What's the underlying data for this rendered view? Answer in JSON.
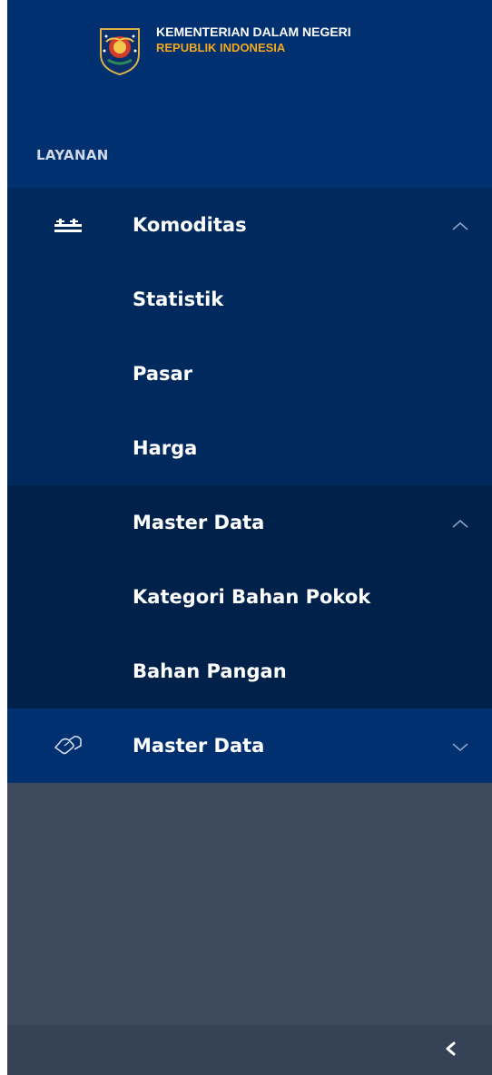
{
  "brand": {
    "title": "KEMENTERIAN DALAM NEGERI",
    "subtitle": "REPUBLIK INDONESIA",
    "logo_icon": "garuda-emblem-icon"
  },
  "section": {
    "label": "LAYANAN"
  },
  "menu": {
    "komoditas": {
      "label": "Komoditas",
      "icon": "market-stall-icon",
      "chevron": "chevron-up-icon",
      "children": [
        {
          "label": "Statistik"
        },
        {
          "label": "Pasar"
        },
        {
          "label": "Harga"
        }
      ]
    },
    "master_data_sub": {
      "label": "Master Data",
      "chevron": "chevron-up-icon",
      "children": [
        {
          "label": "Kategori Bahan Pokok"
        },
        {
          "label": "Bahan Pangan"
        }
      ]
    },
    "master_data": {
      "label": "Master Data",
      "icon": "handshake-icon",
      "chevron": "chevron-down-icon"
    }
  },
  "footer": {
    "collapse_icon": "chevron-left-icon"
  },
  "colors": {
    "header_bg": "#003070",
    "group_bg": "#002a5e",
    "subgroup_bg": "#00214a",
    "empty_bg": "#3d4a5e",
    "footer_bg": "#364356",
    "accent": "#f2a81d"
  }
}
